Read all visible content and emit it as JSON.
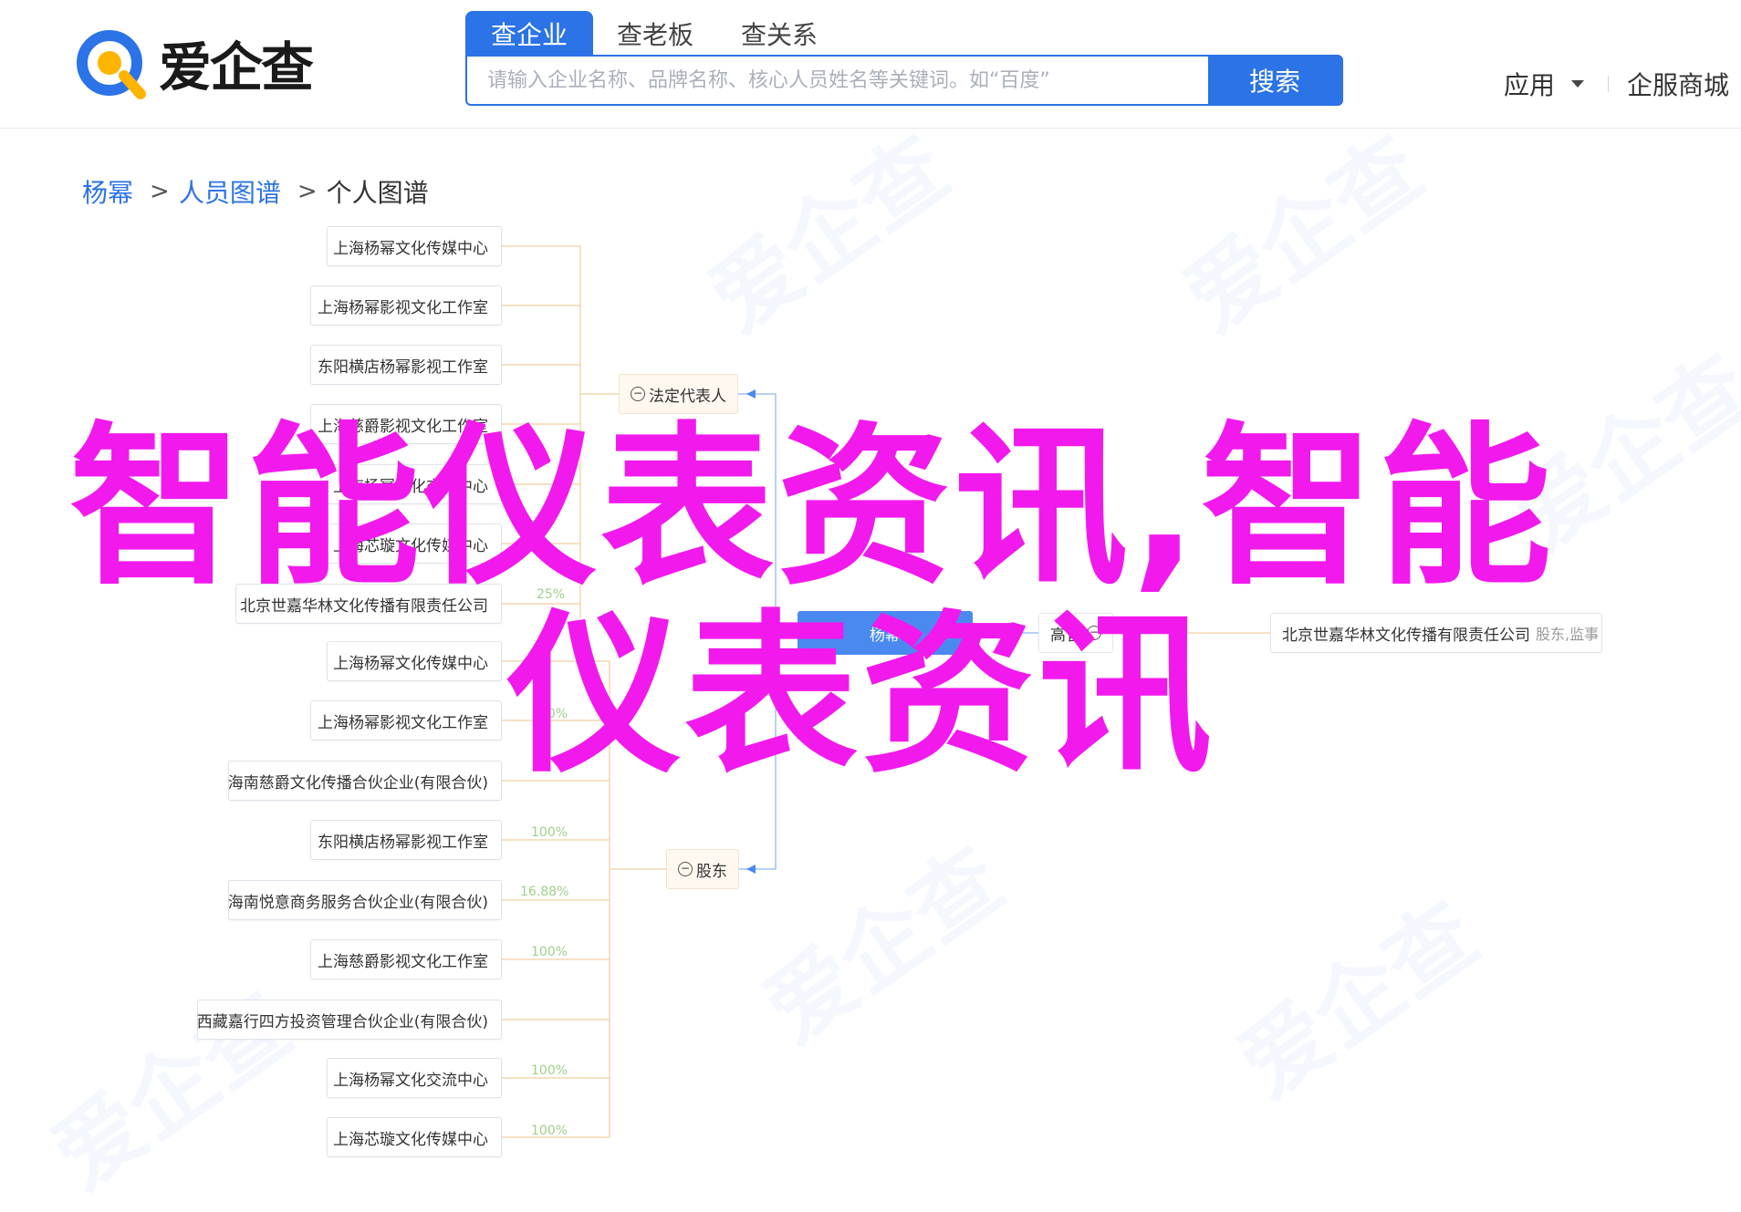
{
  "header": {
    "logo_text": "爱企查",
    "search_tabs": [
      "查企业",
      "查老板",
      "查关系"
    ],
    "search_placeholder": "请输入企业名称、品牌名称、核心人员姓名等关键词。如“百度”",
    "search_button": "搜索",
    "apps_label": "应用",
    "mall_label": "企服商城"
  },
  "breadcrumb": [
    "杨幂",
    "人员图谱",
    "个人图谱"
  ],
  "graph": {
    "center": "杨幂",
    "categories": {
      "legal_rep": "法定代表人",
      "shareholder": "股东",
      "executive": "高管"
    },
    "legal_rep_companies": [
      "上海杨幂文化传媒中心",
      "上海杨幂影视文化工作室",
      "东阳横店杨幂影视工作室",
      "上海慈爵影视文化工作室",
      "上海杨幂文化交流中心",
      "上海芯璇文化传媒中心",
      "北京世嘉华林文化传播有限责任公司"
    ],
    "shareholder_companies": [
      "上海杨幂文化传媒中心",
      "上海杨幂影视文化工作室",
      "海南慈爵文化传播合伙企业(有限合伙)",
      "东阳横店杨幂影视工作室",
      "海南悦意商务服务合伙企业(有限合伙)",
      "上海慈爵影视文化工作室",
      "西藏嘉行四方投资管理合伙企业(有限合伙)",
      "上海杨幂文化交流中心",
      "上海芯璇文化传媒中心"
    ],
    "shareholder_pcts": [
      "25%",
      "100%",
      "100%",
      "16.88%",
      "100%",
      "100%",
      "100%"
    ],
    "executive_company": "北京世嘉华林文化传播有限责任公司",
    "executive_roles": "股东,监事"
  },
  "overlay": {
    "line1": "智能仪表资讯,智能",
    "line2": "仪表资讯"
  },
  "colors": {
    "brand_blue": "#2b73e6",
    "overlay_magenta": "#f219ed",
    "pct_green": "#9fd08a",
    "connector_orange": "#f3d7b0"
  }
}
